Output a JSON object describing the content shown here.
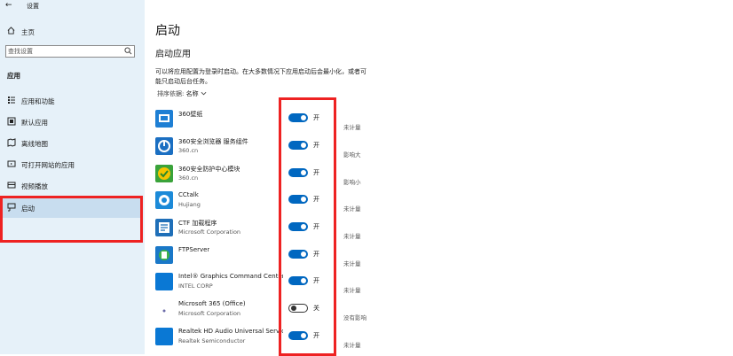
{
  "window": {
    "title": "设置"
  },
  "sidebar": {
    "home": "主页",
    "search_placeholder": "查找设置",
    "section": "应用",
    "items": [
      {
        "label": "应用和功能",
        "icon": "apps-list-icon"
      },
      {
        "label": "默认应用",
        "icon": "default-apps-icon"
      },
      {
        "label": "离线地图",
        "icon": "map-icon"
      },
      {
        "label": "可打开网站的应用",
        "icon": "web-apps-icon"
      },
      {
        "label": "视频播放",
        "icon": "video-icon"
      },
      {
        "label": "启动",
        "icon": "startup-icon",
        "selected": true
      }
    ]
  },
  "main": {
    "title": "启动",
    "subtitle": "启动应用",
    "description": "可以将应用配置为登录时启动。在大多数情况下应用启动后会最小化，或者可能只启动后台任务。",
    "sort_label": "排序依据:",
    "sort_value": "名称",
    "apps": [
      {
        "name": "360壁纸",
        "publisher": "",
        "on": true,
        "state": "开",
        "impact": "未计量",
        "icon_color": "#1e7fd4",
        "icon": "360-wallpaper-icon"
      },
      {
        "name": "360安全浏览器 服务组件",
        "publisher": "360.cn",
        "on": true,
        "state": "开",
        "impact": "影响大",
        "icon_color": "#1b6fc2",
        "icon": "360-browser-icon"
      },
      {
        "name": "360安全防护中心模块",
        "publisher": "360.cn",
        "on": true,
        "state": "开",
        "impact": "影响小",
        "icon_color": "#3aa33a",
        "icon": "360-security-icon"
      },
      {
        "name": "CCtalk",
        "publisher": "Hujiang",
        "on": true,
        "state": "开",
        "impact": "未计量",
        "icon_color": "#1c8ad8",
        "icon": "cctalk-icon"
      },
      {
        "name": "CTF 加载程序",
        "publisher": "Microsoft Corporation",
        "on": true,
        "state": "开",
        "impact": "未计量",
        "icon_color": "#1f6fb8",
        "icon": "ctf-loader-icon"
      },
      {
        "name": "FTPServer",
        "publisher": "",
        "on": true,
        "state": "开",
        "impact": "未计量",
        "icon_color": "#1a78c8",
        "icon": "ftpserver-icon"
      },
      {
        "name": "Intel® Graphics Command Center S...",
        "publisher": "INTEL CORP",
        "on": true,
        "state": "开",
        "impact": "未计量",
        "icon_color": "#0a78d4",
        "icon": "intel-graphics-icon"
      },
      {
        "name": "Microsoft 365 (Office)",
        "publisher": "Microsoft Corporation",
        "on": false,
        "state": "关",
        "impact": "没有影响",
        "icon_color": "#ffffff",
        "icon": "office-icon"
      },
      {
        "name": "Realtek HD Audio Universal Service",
        "publisher": "Realtek Semiconductor",
        "on": true,
        "state": "开",
        "impact": "未计量",
        "icon_color": "#0a78d4",
        "icon": "realtek-audio-icon"
      }
    ]
  }
}
